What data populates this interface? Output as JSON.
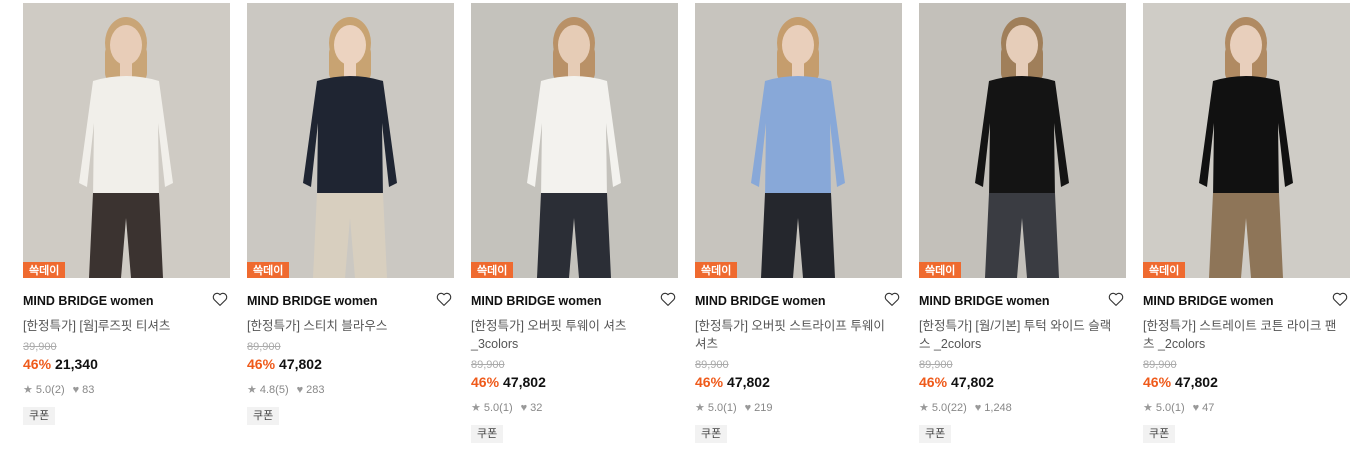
{
  "products": [
    {
      "badge": "쓱데이",
      "brand": "MIND BRIDGE women",
      "name": "[한정특가] [웜]루즈핏 티셔츠",
      "original_price": "39,900",
      "discount": "46%",
      "price": "21,340",
      "rating": "5.0",
      "reviews": "(2)",
      "likes": "83",
      "coupon": "쿠폰",
      "colors": {
        "bg": "#cfcbc4",
        "top": "#f1efea",
        "bottom": "#3b3330",
        "skin": "#e8cdb8",
        "hair": "#c9a577"
      }
    },
    {
      "badge": "쓱데이",
      "brand": "MIND BRIDGE women",
      "name": "[한정특가] 스티치 블라우스",
      "original_price": "89,900",
      "discount": "46%",
      "price": "47,802",
      "rating": "4.8",
      "reviews": "(5)",
      "likes": "283",
      "coupon": "쿠폰",
      "colors": {
        "bg": "#cbc8c2",
        "top": "#1f2532",
        "bottom": "#d8cfbf",
        "skin": "#ecd3c0",
        "hair": "#c8a372"
      }
    },
    {
      "badge": "쓱데이",
      "brand": "MIND BRIDGE women",
      "name": "[한정특가] 오버핏 투웨이 셔츠 _3colors",
      "original_price": "89,900",
      "discount": "46%",
      "price": "47,802",
      "rating": "5.0",
      "reviews": "(1)",
      "likes": "32",
      "coupon": "쿠폰",
      "colors": {
        "bg": "#c4c2bc",
        "top": "#f3f2ee",
        "bottom": "#2b2e36",
        "skin": "#e6ccb6",
        "hair": "#b99167"
      }
    },
    {
      "badge": "쓱데이",
      "brand": "MIND BRIDGE women",
      "name": "[한정특가] 오버핏 스트라이프 투웨이 셔츠",
      "original_price": "89,900",
      "discount": "46%",
      "price": "47,802",
      "rating": "5.0",
      "reviews": "(1)",
      "likes": "219",
      "coupon": "쿠폰",
      "colors": {
        "bg": "#c7c4be",
        "top": "#88a8d8",
        "bottom": "#25272d",
        "skin": "#e9cfbb",
        "hair": "#c59d6d"
      }
    },
    {
      "badge": "쓱데이",
      "brand": "MIND BRIDGE women",
      "name": "[한정특가] [웜/기본] 투턱 와이드 슬랙스 _2colors",
      "original_price": "89,900",
      "discount": "46%",
      "price": "47,802",
      "rating": "5.0",
      "reviews": "(22)",
      "likes": "1,248",
      "coupon": "쿠폰",
      "colors": {
        "bg": "#c3c0ba",
        "top": "#141414",
        "bottom": "#3a3c42",
        "skin": "#e6cdb9",
        "hair": "#a07f5a"
      }
    },
    {
      "badge": "쓱데이",
      "brand": "MIND BRIDGE women",
      "name": "[한정특가] 스트레이트 코튼 라이크 팬츠 _2colors",
      "original_price": "89,900",
      "discount": "46%",
      "price": "47,802",
      "rating": "5.0",
      "reviews": "(1)",
      "likes": "47",
      "coupon": "쿠폰",
      "colors": {
        "bg": "#cfccc6",
        "top": "#111111",
        "bottom": "#8e7558",
        "skin": "#e8cfbc",
        "hair": "#b08a62"
      }
    }
  ]
}
